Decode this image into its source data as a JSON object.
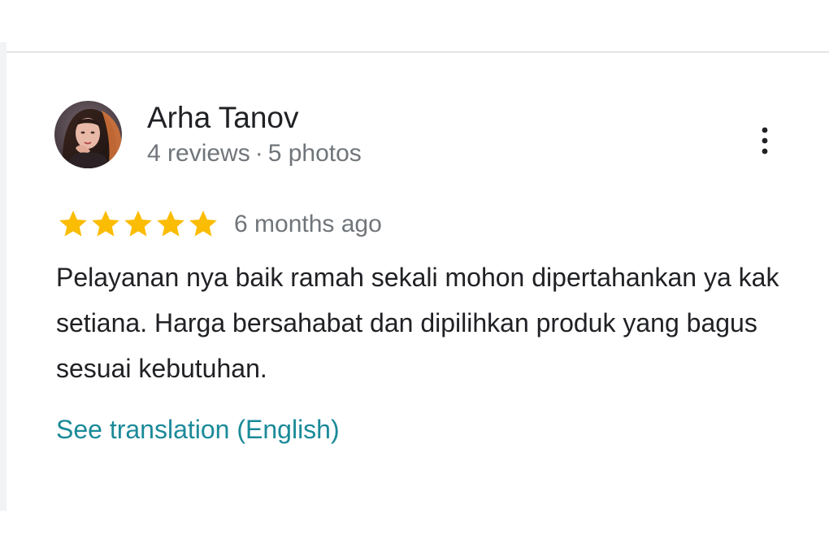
{
  "reviewer": {
    "name": "Arha Tanov",
    "reviews": "4 reviews",
    "separator": "·",
    "photos": "5 photos"
  },
  "review": {
    "rating": 5,
    "max_rating": 5,
    "time": "6 months ago",
    "text": "Pelayanan nya baik ramah sekali mohon dipertahankan ya kak setiana. Harga bersahabat dan dipilihkan produk yang bagus sesuai kebutuhan.",
    "translate_link": "See translation (English)"
  },
  "icons": {
    "more_options": "more-vert-icon",
    "rating": "star-icon"
  },
  "colors": {
    "star": "#fbbc04",
    "link": "#1b8a99",
    "name": "#202124",
    "secondary": "#70757a",
    "divider": "#e3e5e8"
  }
}
